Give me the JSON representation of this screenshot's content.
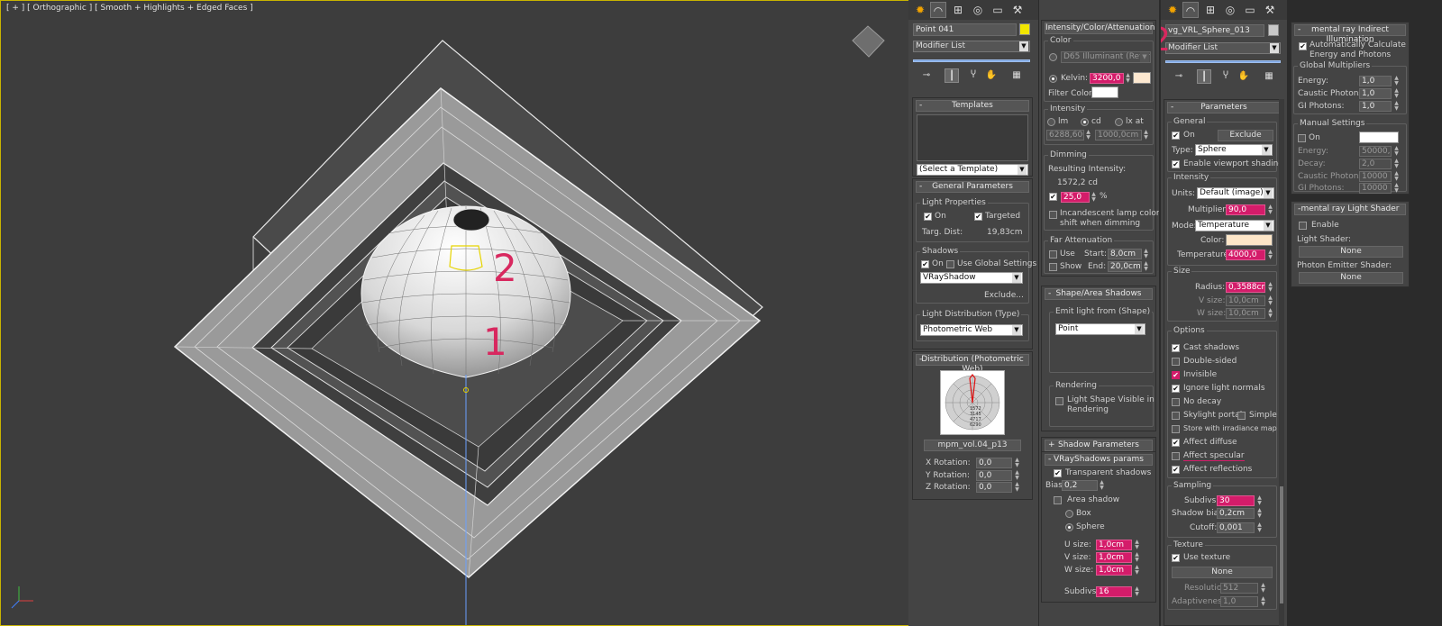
{
  "viewport": {
    "label": "[ + ] [ Orthographic ] [ Smooth + Highlights + Edged Faces ]",
    "marker_1": "1",
    "marker_2": "2",
    "gizmo_icon": "viewcube-icon",
    "axis_icon": "axis-tripod-icon"
  },
  "panel_photometric": {
    "marker": "1",
    "object_name": "Point 041",
    "object_color": "#f2e600",
    "modifier_list": "Modifier List",
    "templates": {
      "title": "Templates",
      "select": "(Select a Template)"
    },
    "general": {
      "title": "General Parameters",
      "light_props": "Light Properties",
      "on": "On",
      "targeted": "Targeted",
      "targ_dist_label": "Targ. Dist:",
      "targ_dist_value": "19,83cm",
      "shadows": "Shadows",
      "shadows_on": "On",
      "use_global": "Use Global Settings",
      "shadow_type": "VRayShadow",
      "exclude": "Exclude...",
      "distribution_label": "Light Distribution (Type)",
      "distribution_value": "Photometric Web"
    },
    "distribution": {
      "title": "Distribution (Photometric Web)",
      "web_file": "mpm_vol.04_p13",
      "x_rot_label": "X Rotation:",
      "x_rot": "0,0",
      "y_rot_label": "Y Rotation:",
      "y_rot": "0,0",
      "z_rot_label": "Z Rotation:",
      "z_rot": "0,0",
      "web_ticks": [
        "1572",
        "3145",
        "4717",
        "6290"
      ]
    },
    "intensity": {
      "title": "Intensity/Color/Attenuation",
      "color": "Color",
      "d65": "D65 Illuminant (Refere",
      "kelvin_label": "Kelvin:",
      "kelvin": "3200,0",
      "kelvin_color": "#fde8d0",
      "filter_color": "Filter Color:",
      "intensity": "Intensity",
      "lm": "lm",
      "cd": "cd",
      "lx_at": "lx at",
      "val1": "6288,600",
      "val2": "1000,0cm",
      "dimming": "Dimming",
      "resulting": "Resulting Intensity:",
      "result_val": "1572,2 cd",
      "percent": "25,0",
      "percent_sign": "%",
      "incandescent_1": "Incandescent lamp color",
      "incandescent_2": "shift when dimming",
      "far_atten": "Far Attenuation",
      "use": "Use",
      "show": "Show",
      "start_label": "Start:",
      "start": "8,0cm",
      "end_label": "End:",
      "end": "20,0cm"
    },
    "shape": {
      "title": "Shape/Area Shadows",
      "emit": "Emit light from (Shape)",
      "emit_value": "Point",
      "rendering": "Rendering",
      "visible_1": "Light Shape Visible in",
      "visible_2": "Rendering"
    },
    "shadow_params": {
      "title": "Shadow Parameters",
      "sign": "+"
    },
    "vray_shadows": {
      "title": "VRayShadows params",
      "transparent": "Transparent shadows",
      "bias_label": "Bias:",
      "bias": "0,2",
      "area": "Area shadow",
      "box": "Box",
      "sphere": "Sphere",
      "u_label": "U size:",
      "u": "1,0cm",
      "v_label": "V size:",
      "v": "1,0cm",
      "w_label": "W size:",
      "w": "1,0cm",
      "subdivs_label": "Subdivs:",
      "subdivs": "16"
    }
  },
  "panel_vray": {
    "marker": "2",
    "object_name": "vg_VRL_Sphere_013",
    "object_color": "#c8c8c8",
    "modifier_list": "Modifier List",
    "params": {
      "title": "Parameters",
      "general": "General",
      "on": "On",
      "exclude": "Exclude",
      "type_label": "Type:",
      "type": "Sphere",
      "viewport_shading": "Enable viewport shading",
      "intensity": "Intensity",
      "units_label": "Units:",
      "units": "Default (image)",
      "multiplier_label": "Multiplier:",
      "multiplier": "90,0",
      "mode_label": "Mode:",
      "mode": "Temperature",
      "color_label": "Color:",
      "color_swatch": "#fde6c8",
      "temp_label": "Temperature:",
      "temp": "4000,0",
      "size": "Size",
      "radius_label": "Radius:",
      "radius": "0,3588cm",
      "vsize_label": "V size:",
      "vsize": "10,0cm",
      "wsize_label": "W size:",
      "wsize": "10,0cm",
      "options": "Options",
      "opt_cast": "Cast shadows",
      "opt_double": "Double-sided",
      "opt_invisible": "Invisible",
      "opt_ignore": "Ignore light normals",
      "opt_nodecay": "No decay",
      "opt_skylight": "Skylight portal",
      "opt_simple": "Simple",
      "opt_store": "Store with irradiance map",
      "opt_diffuse": "Affect diffuse",
      "opt_specular": "Affect specular",
      "opt_reflections": "Affect reflections",
      "sampling": "Sampling",
      "subdivs_label": "Subdivs:",
      "subdivs": "30",
      "sbias_label": "Shadow bias:",
      "sbias": "0,2cm",
      "cutoff_label": "Cutoff:",
      "cutoff": "0,001",
      "texture": "Texture",
      "use_texture": "Use texture",
      "none": "None",
      "res_label": "Resolution:",
      "res": "512",
      "adapt_label": "Adaptiveness:",
      "adapt": "1,0"
    }
  },
  "panel_mr": {
    "gi_title": "mental ray Indirect Illumination",
    "auto_1": "Automatically Calculate",
    "auto_2": "Energy and Photons",
    "global_mult": "Global Multipliers",
    "energy_label": "Energy:",
    "energy": "1,0",
    "caustic_label": "Caustic Photons:",
    "caustic": "1,0",
    "gi_label": "GI Photons:",
    "gi": "1,0",
    "manual": "Manual Settings",
    "m_on": "On",
    "m_energy_label": "Energy:",
    "m_energy": "50000,0",
    "m_decay_label": "Decay:",
    "m_decay": "2,0",
    "m_caustic_label": "Caustic Photons:",
    "m_caustic": "10000",
    "m_gi_label": "GI Photons:",
    "m_gi": "10000",
    "shader_title": "mental ray Light Shader",
    "enable": "Enable",
    "light_shader": "Light Shader:",
    "none1": "None",
    "photon_shader": "Photon Emitter Shader:",
    "none2": "None"
  },
  "icons": [
    "sun-icon",
    "modify-icon",
    "hierarchy-icon",
    "motion-icon",
    "display-icon",
    "utilities-icon",
    "pin-icon",
    "stack-icon",
    "funnel-icon",
    "hand-icon",
    "config-icon"
  ]
}
